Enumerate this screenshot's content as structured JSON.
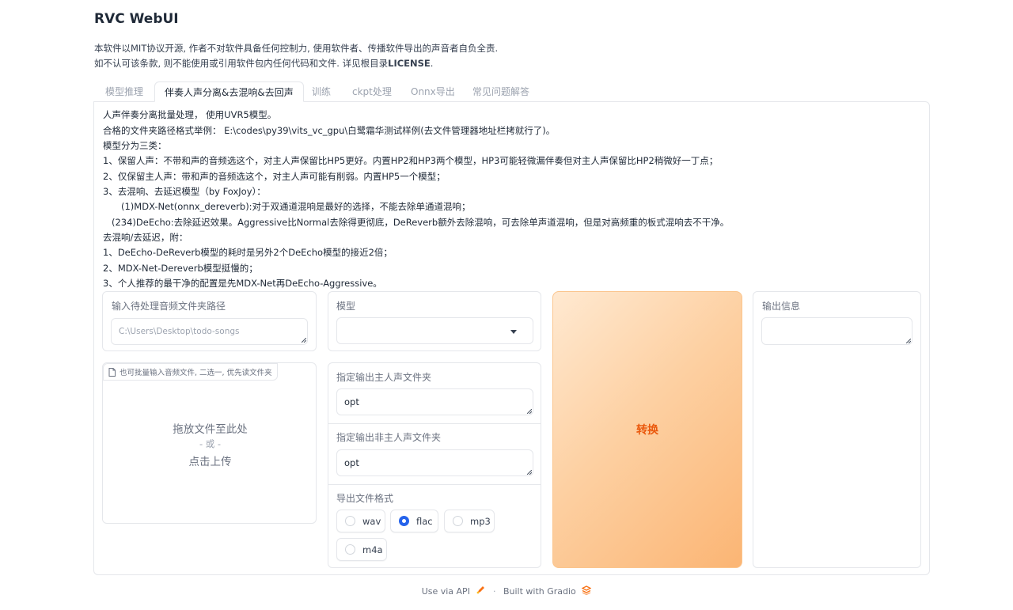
{
  "app": {
    "title": "RVC WebUI"
  },
  "intro": {
    "line1": "本软件以MIT协议开源, 作者不对软件具备任何控制力, 使用软件者、传播软件导出的声音者自负全责.",
    "line2_prefix": "如不认可该条款, 则不能使用或引用软件包内任何代码和文件. 详见根目录",
    "line2_bold": "LICENSE",
    "line2_suffix": "."
  },
  "tabs": [
    {
      "label": "模型推理",
      "active": false
    },
    {
      "label": "伴奏人声分离&去混响&去回声",
      "active": true
    },
    {
      "label": "训练",
      "active": false
    },
    {
      "label": "ckpt处理",
      "active": false
    },
    {
      "label": "Onnx导出",
      "active": false
    },
    {
      "label": "常见问题解答",
      "active": false
    }
  ],
  "description": [
    "人声伴奏分离批量处理， 使用UVR5模型。",
    "合格的文件夹路径格式举例： E:\\codes\\py39\\vits_vc_gpu\\白鹭霜华测试样例(去文件管理器地址栏拷就行了)。",
    "模型分为三类：",
    "1、保留人声：不带和声的音频选这个，对主人声保留比HP5更好。内置HP2和HP3两个模型，HP3可能轻微漏伴奏但对主人声保留比HP2稍微好一丁点；",
    "2、仅保留主人声：带和声的音频选这个，对主人声可能有削弱。内置HP5一个模型；",
    "3、去混响、去延迟模型（by FoxJoy）：",
    "(1)MDX-Net(onnx_dereverb):对于双通道混响是最好的选择，不能去除单通道混响；",
    "(234)DeEcho:去除延迟效果。Aggressive比Normal去除得更彻底，DeReverb额外去除混响，可去除单声道混响，但是对高频重的板式混响去不干净。",
    "去混响/去延迟，附：",
    "1、DeEcho-DeReverb模型的耗时是另外2个DeEcho模型的接近2倍；",
    "2、MDX-Net-Dereverb模型挺慢的；",
    "3、个人推荐的最干净的配置是先MDX-Net再DeEcho-Aggressive。"
  ],
  "input_path": {
    "label": "输入待处理音频文件夹路径",
    "placeholder": "C:\\Users\\Desktop\\todo-songs",
    "value": ""
  },
  "model": {
    "label": "模型",
    "value": ""
  },
  "upload": {
    "badge": "也可批量输入音频文件, 二选一, 优先读文件夹",
    "drop_text": "拖放文件至此处",
    "or_text": "- 或 -",
    "click_text": "点击上传"
  },
  "vocal_out": {
    "label": "指定输出主人声文件夹",
    "value": "opt"
  },
  "ins_out": {
    "label": "指定输出非主人声文件夹",
    "value": "opt"
  },
  "format": {
    "label": "导出文件格式",
    "options": [
      "wav",
      "flac",
      "mp3",
      "m4a"
    ],
    "selected": "flac"
  },
  "convert_button": "转换",
  "output_info": {
    "label": "输出信息",
    "value": ""
  },
  "footer": {
    "api": "Use via API",
    "sep": "·",
    "built": "Built with Gradio"
  },
  "colors": {
    "accent": "#ea580c",
    "radio_selected": "#2563eb",
    "border": "#e5e7eb"
  }
}
